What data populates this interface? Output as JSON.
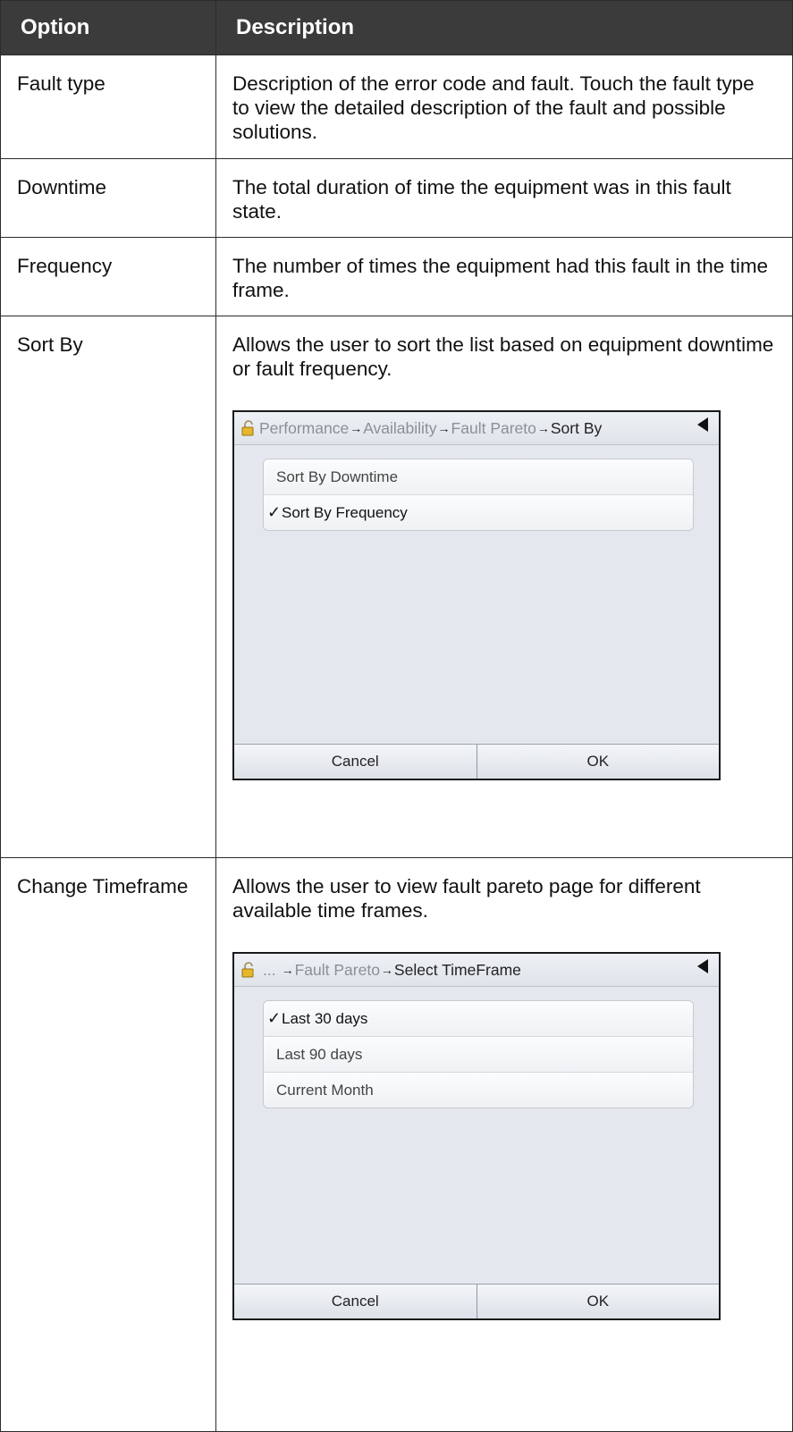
{
  "table": {
    "header_option": "Option",
    "header_description": "Description"
  },
  "rows": [
    {
      "option": "Fault type",
      "description": "Description of the error code and fault. Touch the fault type to view the detailed description of the fault and possible solutions."
    },
    {
      "option": "Downtime",
      "description": "The total duration of time the equipment was in this fault state."
    },
    {
      "option": "Frequency",
      "description": "The number of times the equipment had this fault in the time frame."
    },
    {
      "option": "Sort By",
      "description": "Allows the user to sort the list based on equipment downtime or fault frequency."
    },
    {
      "option": "Change Timeframe",
      "description": "Allows the user to view fault pareto page for different available time frames."
    }
  ],
  "sort_screen": {
    "breadcrumb": [
      "Performance",
      "Availability",
      "Fault Pareto",
      "Sort By"
    ],
    "items": [
      "Sort By Downtime",
      "Sort By Frequency"
    ],
    "selected": "Sort By Frequency",
    "cancel": "Cancel",
    "ok": "OK",
    "check_mark": "✓",
    "arrow": "→",
    "icons": [
      "lock-icon",
      "back-arrow-icon",
      "checkmark-icon"
    ]
  },
  "timeframe_screen": {
    "breadcrumb": [
      "...",
      "Fault Pareto",
      "Select TimeFrame"
    ],
    "items": [
      "Last 30 days",
      "Last 90 days",
      "Current Month"
    ],
    "selected": "Last 30 days",
    "cancel": "Cancel",
    "ok": "OK",
    "check_mark": "✓",
    "arrow": "→"
  },
  "colors": {
    "header_bg": "#3b3b3b",
    "screen_bg": "#e4e8ee"
  }
}
